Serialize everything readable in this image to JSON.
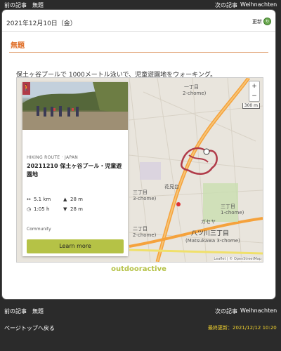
{
  "topnav": {
    "prev": "前の記事",
    "untitled": "無題",
    "next": "次の記事",
    "weihnachten": "Weihnachten"
  },
  "post": {
    "date": "2021年12月10日（金）",
    "update_label": "更新",
    "title": "無題",
    "description": "保土ヶ谷プールで 1000メートル泳いで、児童遊園地をウォーキング。"
  },
  "route": {
    "type": "HIKING ROUTE · JAPAN",
    "name": "20211210 保土ヶ谷プール・児童遊園地",
    "distance": "5.1 km",
    "ascent": "28 m",
    "duration": "1:05 h",
    "descent": "28 m",
    "community": "Community",
    "cta": "Learn more"
  },
  "map": {
    "labels": [
      "一丁目",
      "2-chome)",
      "三丁目",
      "3-chome)",
      "三丁目",
      "1-chome)",
      "二丁目",
      "2-chome)",
      "八ツ川三丁目",
      "(Matsukawa 3-chome)",
      "花見台",
      "ガセヤ"
    ],
    "scale": "300 m",
    "zoom_in": "+",
    "zoom_out": "−",
    "attribution": "Leaflet | © OpenStreetMap"
  },
  "brand": "outdooractive",
  "bottomnav": {
    "prev": "前の記事",
    "untitled": "無題",
    "next": "次の記事",
    "weihnachten": "Weihnachten",
    "back_to_top": "ページトップへ戻る",
    "last_updated": "最終更新：2021/12/12 10:20"
  },
  "colors": {
    "accent": "#e0702a",
    "brand": "#b5c246",
    "route": "#b03a48",
    "footer_update": "#f2d22e"
  }
}
